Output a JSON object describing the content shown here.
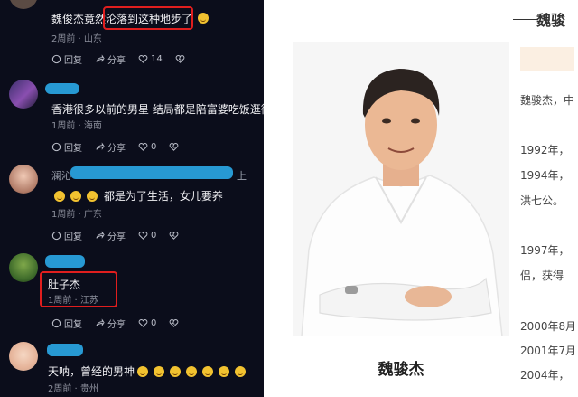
{
  "feed": {
    "comments": [
      {
        "text": "魏俊杰竟然沦落到这种地步了",
        "time": "2周前",
        "location": "山东",
        "reply_label": "回复",
        "share_label": "分享",
        "likes": "14"
      },
      {
        "text": "香港很多以前的男星 结局都是陪富婆吃饭逛街",
        "time": "1周前",
        "location": "海南",
        "reply_label": "回复",
        "share_label": "分享",
        "likes": "0"
      },
      {
        "name_prefix": "澜沁",
        "name_suffix": "上",
        "text": "都是为了生活，女儿要养",
        "time": "1周前",
        "location": "广东",
        "reply_label": "回复",
        "share_label": "分享",
        "likes": "0"
      },
      {
        "text": "肚子杰",
        "time": "1周前",
        "location": "江苏",
        "reply_label": "回复",
        "share_label": "分享",
        "likes": "0"
      },
      {
        "text": "天呐，曾经的男神",
        "time": "2周前",
        "location": "贵州"
      }
    ],
    "highlight_color": "#e01e1e",
    "name_blur_color": "#2aa8e8"
  },
  "profile": {
    "section_title": "魏骏",
    "photo_caption": "魏骏杰",
    "intro": "魏骏杰，中",
    "timeline": [
      "1992年，",
      "1994年，",
      "洪七公。",
      "1997年，",
      "侣，获得",
      "2000年8月",
      "2001年7月",
      "2004年，"
    ]
  }
}
